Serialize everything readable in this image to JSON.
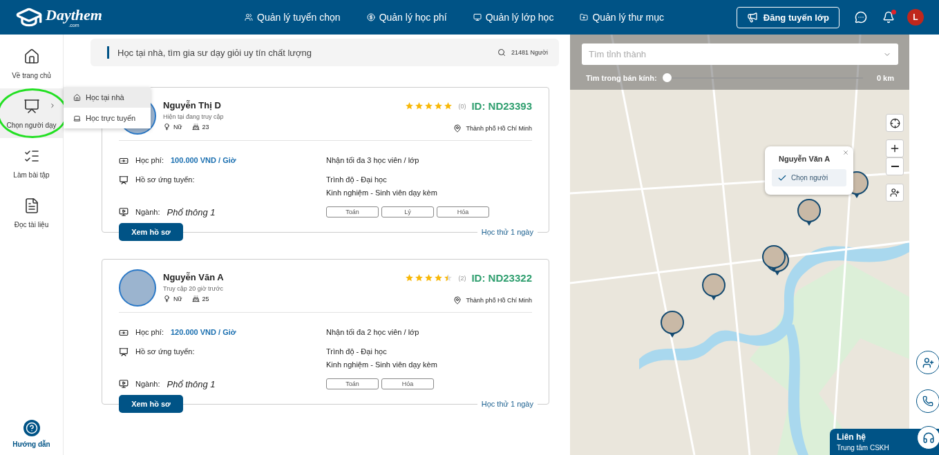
{
  "header": {
    "logo": "Daythem",
    "logo_sub": ".com",
    "nav": [
      "Quản lý tuyển chọn",
      "Quản lý học phí",
      "Quản lý lớp học",
      "Quản lý thư mục"
    ],
    "post_button": "Đăng tuyến lớp",
    "notification": true,
    "avatar": "L"
  },
  "sidebar": {
    "items": [
      {
        "label": "Về trang chủ",
        "selected": false,
        "highlighted": false
      },
      {
        "label": "Chọn người dạy",
        "selected": true,
        "highlighted": true,
        "submenu": [
          {
            "label": "Học tại nhà",
            "selected": true
          },
          {
            "label": "Học trực tuyến",
            "selected": false
          }
        ]
      },
      {
        "label": "Làm bài tập",
        "selected": false,
        "highlighted": false
      },
      {
        "label": "Đọc tài liệu",
        "selected": false,
        "highlighted": false
      }
    ],
    "help": "Hướng dẫn"
  },
  "search": {
    "title": "Học tại nhà, tìm gia sư dạy giỏi uy tín chất lượng",
    "count": "21481 Người"
  },
  "tutors": [
    {
      "name": "Nguyễn Thị D",
      "status": "Hiện tại đang truy cập",
      "gender": "Nữ",
      "age": "23",
      "stars": 5,
      "reviews": "(0)",
      "id": "ID: ND23393",
      "location": "Thành phố Hồ Chí Minh",
      "fee_label": "Học phí:",
      "fee": "100.000 VND / Giờ",
      "capacity": "Nhận tối đa 3 học viên / lớp",
      "profile_label": "Hồ sơ ứng tuyển:",
      "level": "Trình độ - Đại học",
      "experience": "Kinh nghiệm - Sinh viên dạy kèm",
      "major_label": "Ngành:",
      "major": "Phổ thông 1",
      "subjects": [
        "Toán",
        "Lý",
        "Hóa"
      ],
      "button": "Xem hồ sơ",
      "trial": "Học thử 1 ngày"
    },
    {
      "name": "Nguyễn Văn A",
      "status": "Truy cập 20 giờ trước",
      "gender": "Nữ",
      "age": "25",
      "stars": 4.5,
      "reviews": "(2)",
      "id": "ID: ND23322",
      "location": "Thành phố Hồ Chí Minh",
      "fee_label": "Học phí:",
      "fee": "120.000 VND / Giờ",
      "capacity": "Nhận tối đa 2 học viên / lớp",
      "profile_label": "Hồ sơ ứng tuyển:",
      "level": "Trình độ - Đại học",
      "experience": "Kinh nghiệm - Sinh viên dạy kèm",
      "major_label": "Ngành:",
      "major": "Phổ thông 1",
      "subjects": [
        "Toán",
        "Hóa"
      ],
      "button": "Xem hồ sơ",
      "trial": "Học thử 1 ngày"
    }
  ],
  "map": {
    "province_placeholder": "Tìm tỉnh thành",
    "radius_label": "Tìm trong bán kính:",
    "radius": {
      "level": 0
    },
    "radius_value": "0 km",
    "popup": {
      "name": "Nguyễn Văn A",
      "button": "Chọn người"
    }
  },
  "contact": {
    "title": "Liên hệ",
    "subtitle": "Trung tâm CSKH"
  }
}
